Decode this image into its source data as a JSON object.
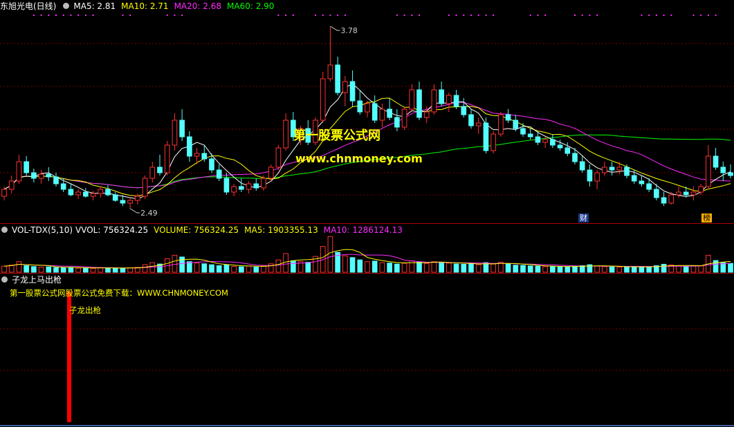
{
  "main": {
    "title": "东旭光电(日线)",
    "ma_labels": [
      {
        "text": "MA5: 2.81",
        "color": "#ffffff"
      },
      {
        "text": "MA10: 2.71",
        "color": "#ffff00"
      },
      {
        "text": "MA20: 2.68",
        "color": "#ff2bff"
      },
      {
        "text": "MA60: 2.90",
        "color": "#00ff00"
      }
    ],
    "high_label": "3.78",
    "low_label": "2.49",
    "watermark_cn": "第一股票公式网",
    "watermark_url": "www.chnmoney.com",
    "tag_cai": "财",
    "tag_bang": "榜"
  },
  "volume": {
    "title": "VOL-TDX(5,10)",
    "labels": [
      {
        "text": "VVOL: 756324.25",
        "color": "#ffffff"
      },
      {
        "text": "VOLUME: 756324.25",
        "color": "#ffff00"
      },
      {
        "text": "MA5: 1903355.13",
        "color": "#ffff00"
      },
      {
        "text": "MA10: 1286124.13",
        "color": "#ff2bff"
      }
    ]
  },
  "indicator": {
    "title": "子龙上马出枪",
    "download_text": "第一股票公式网股票公式免费下载：WWW.CHNMONEY.COM",
    "signal_label": "子龙出枪"
  },
  "colors": {
    "up": "#ff3232",
    "down": "#54ffff",
    "ma5": "#ffffff",
    "ma10": "#ffff00",
    "ma20": "#ff2bff",
    "ma60": "#00ff00",
    "signal": "#ff0000"
  },
  "chart_data": {
    "type": "candlestick",
    "price_ylim": [
      2.38,
      3.86
    ],
    "volume_ylim": [
      0,
      3300000
    ],
    "candles": [
      [
        2.55,
        2.62,
        2.52,
        2.6
      ],
      [
        2.6,
        2.7,
        2.57,
        2.66
      ],
      [
        2.66,
        2.85,
        2.64,
        2.8
      ],
      [
        2.8,
        2.84,
        2.7,
        2.72
      ],
      [
        2.72,
        2.75,
        2.65,
        2.68
      ],
      [
        2.68,
        2.74,
        2.64,
        2.71
      ],
      [
        2.71,
        2.76,
        2.66,
        2.69
      ],
      [
        2.69,
        2.72,
        2.62,
        2.64
      ],
      [
        2.64,
        2.68,
        2.58,
        2.6
      ],
      [
        2.6,
        2.64,
        2.55,
        2.56
      ],
      [
        2.56,
        2.6,
        2.53,
        2.58
      ],
      [
        2.58,
        2.61,
        2.54,
        2.55
      ],
      [
        2.55,
        2.59,
        2.52,
        2.57
      ],
      [
        2.57,
        2.62,
        2.54,
        2.6
      ],
      [
        2.6,
        2.63,
        2.55,
        2.56
      ],
      [
        2.56,
        2.58,
        2.51,
        2.52
      ],
      [
        2.52,
        2.56,
        2.48,
        2.5
      ],
      [
        2.5,
        2.54,
        2.46,
        2.52
      ],
      [
        2.52,
        2.57,
        2.49,
        2.55
      ],
      [
        2.55,
        2.7,
        2.53,
        2.68
      ],
      [
        2.68,
        2.8,
        2.65,
        2.76
      ],
      [
        2.76,
        2.85,
        2.7,
        2.72
      ],
      [
        2.72,
        2.95,
        2.7,
        2.92
      ],
      [
        2.92,
        3.15,
        2.88,
        3.1
      ],
      [
        3.1,
        3.18,
        2.95,
        2.98
      ],
      [
        2.98,
        3.02,
        2.8,
        2.84
      ],
      [
        2.84,
        2.9,
        2.78,
        2.86
      ],
      [
        2.86,
        2.92,
        2.8,
        2.82
      ],
      [
        2.82,
        2.86,
        2.72,
        2.74
      ],
      [
        2.74,
        2.78,
        2.66,
        2.68
      ],
      [
        2.68,
        2.72,
        2.56,
        2.58
      ],
      [
        2.58,
        2.64,
        2.55,
        2.62
      ],
      [
        2.62,
        2.68,
        2.58,
        2.6
      ],
      [
        2.6,
        2.66,
        2.57,
        2.64
      ],
      [
        2.64,
        2.68,
        2.59,
        2.61
      ],
      [
        2.61,
        2.7,
        2.59,
        2.68
      ],
      [
        2.68,
        2.78,
        2.66,
        2.76
      ],
      [
        2.76,
        2.92,
        2.74,
        2.9
      ],
      [
        2.9,
        3.15,
        2.88,
        3.1
      ],
      [
        3.1,
        3.16,
        2.95,
        2.98
      ],
      [
        2.98,
        3.06,
        2.92,
        3.04
      ],
      [
        3.04,
        3.1,
        2.92,
        2.94
      ],
      [
        2.94,
        3.12,
        2.92,
        3.1
      ],
      [
        3.1,
        3.45,
        3.08,
        3.4
      ],
      [
        3.4,
        3.78,
        3.38,
        3.5
      ],
      [
        3.5,
        3.56,
        3.28,
        3.3
      ],
      [
        3.3,
        3.42,
        3.2,
        3.38
      ],
      [
        3.38,
        3.46,
        3.2,
        3.24
      ],
      [
        3.24,
        3.32,
        3.14,
        3.16
      ],
      [
        3.16,
        3.24,
        3.12,
        3.22
      ],
      [
        3.22,
        3.28,
        3.08,
        3.1
      ],
      [
        3.1,
        3.22,
        3.05,
        3.18
      ],
      [
        3.18,
        3.26,
        3.1,
        3.12
      ],
      [
        3.12,
        3.18,
        3.02,
        3.05
      ],
      [
        3.05,
        3.2,
        3.03,
        3.18
      ],
      [
        3.18,
        3.36,
        3.16,
        3.32
      ],
      [
        3.32,
        3.38,
        3.1,
        3.12
      ],
      [
        3.12,
        3.2,
        3.08,
        3.16
      ],
      [
        3.16,
        3.36,
        3.14,
        3.32
      ],
      [
        3.32,
        3.38,
        3.2,
        3.22
      ],
      [
        3.22,
        3.3,
        3.16,
        3.28
      ],
      [
        3.28,
        3.32,
        3.18,
        3.2
      ],
      [
        3.2,
        3.26,
        3.12,
        3.14
      ],
      [
        3.14,
        3.18,
        3.04,
        3.06
      ],
      [
        3.06,
        3.12,
        3.0,
        3.08
      ],
      [
        3.08,
        3.12,
        2.86,
        2.88
      ],
      [
        2.88,
        3.02,
        2.86,
        3.0
      ],
      [
        3.0,
        3.16,
        2.98,
        3.14
      ],
      [
        3.14,
        3.18,
        3.08,
        3.1
      ],
      [
        3.1,
        3.14,
        3.02,
        3.04
      ],
      [
        3.04,
        3.08,
        2.98,
        3.0
      ],
      [
        3.0,
        3.04,
        2.96,
        2.98
      ],
      [
        2.98,
        3.02,
        2.92,
        2.94
      ],
      [
        2.94,
        2.98,
        2.9,
        2.96
      ],
      [
        2.96,
        3.0,
        2.9,
        2.92
      ],
      [
        2.92,
        2.96,
        2.88,
        2.9
      ],
      [
        2.9,
        2.94,
        2.84,
        2.86
      ],
      [
        2.86,
        2.9,
        2.78,
        2.8
      ],
      [
        2.8,
        2.84,
        2.72,
        2.74
      ],
      [
        2.74,
        2.78,
        2.62,
        2.66
      ],
      [
        2.66,
        2.74,
        2.6,
        2.72
      ],
      [
        2.72,
        2.8,
        2.7,
        2.76
      ],
      [
        2.76,
        2.8,
        2.7,
        2.74
      ],
      [
        2.74,
        2.8,
        2.71,
        2.76
      ],
      [
        2.76,
        2.78,
        2.68,
        2.7
      ],
      [
        2.7,
        2.74,
        2.64,
        2.66
      ],
      [
        2.66,
        2.7,
        2.62,
        2.64
      ],
      [
        2.64,
        2.68,
        2.58,
        2.6
      ],
      [
        2.6,
        2.64,
        2.52,
        2.54
      ],
      [
        2.54,
        2.58,
        2.48,
        2.5
      ],
      [
        2.5,
        2.58,
        2.49,
        2.56
      ],
      [
        2.56,
        2.62,
        2.54,
        2.58
      ],
      [
        2.58,
        2.62,
        2.54,
        2.56
      ],
      [
        2.56,
        2.62,
        2.52,
        2.58
      ],
      [
        2.58,
        2.64,
        2.56,
        2.62
      ],
      [
        2.62,
        2.92,
        2.6,
        2.84
      ],
      [
        2.84,
        2.9,
        2.74,
        2.76
      ],
      [
        2.76,
        2.8,
        2.66,
        2.72
      ],
      [
        2.72,
        2.78,
        2.68,
        2.7
      ]
    ],
    "volumes": [
      520000,
      610000,
      900000,
      560000,
      480000,
      430000,
      460000,
      400000,
      380000,
      420000,
      350000,
      360000,
      330000,
      400000,
      380000,
      340000,
      330000,
      370000,
      420000,
      650000,
      820000,
      700000,
      1150000,
      1450000,
      1300000,
      900000,
      780000,
      720000,
      640000,
      560000,
      620000,
      500000,
      470000,
      520000,
      440000,
      560000,
      720000,
      1050000,
      1600000,
      980000,
      900000,
      850000,
      1350000,
      2200000,
      3050000,
      1700000,
      1400000,
      1250000,
      1050000,
      900000,
      950000,
      820000,
      780000,
      700000,
      760000,
      980000,
      880000,
      760000,
      900000,
      840000,
      780000,
      700000,
      680000,
      720000,
      650000,
      820000,
      700000,
      860000,
      720000,
      600000,
      580000,
      540000,
      520000,
      480000,
      500000,
      460000,
      480000,
      520000,
      560000,
      640000,
      520000,
      480000,
      460000,
      440000,
      460000,
      480000,
      440000,
      460000,
      560000,
      680000,
      620000,
      540000,
      500000,
      520000,
      560000,
      1450000,
      1000000,
      820000,
      756324
    ]
  }
}
